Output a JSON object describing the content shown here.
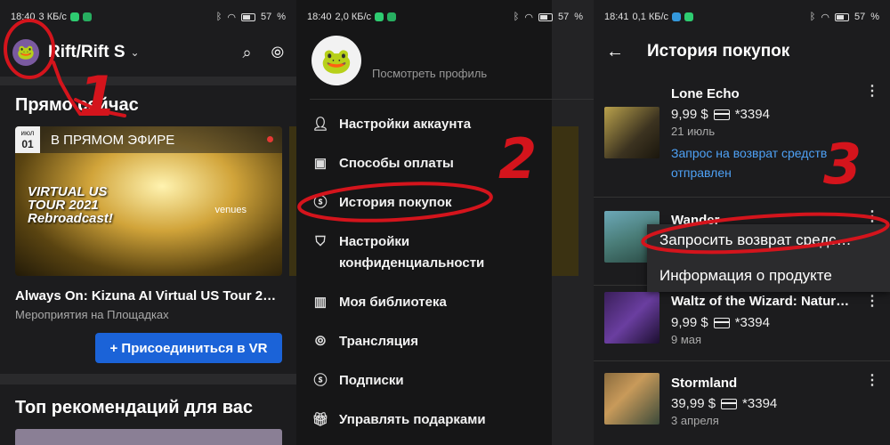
{
  "panel1": {
    "status": {
      "time": "18:40",
      "speed": "3 КБ/с",
      "battery": "57"
    },
    "title": "Rift/Rift S",
    "section_now": "Прямо сейчас",
    "live_label": "В ПРЯМОМ ЭФИРЕ",
    "date_month": "июл",
    "date_day": "01",
    "card_art_text": "VIRTUAL US TOUR 2021 Rebroadcast!",
    "card_art_brand": "venues",
    "event_title": "Always On: Kizuna AI Virtual US Tour 2…",
    "event_sub": "Мероприятия на Площадках",
    "join_button": "+ Присоединиться в VR",
    "section_rec": "Топ рекомендаций для вас",
    "annotation": "1"
  },
  "panel2": {
    "status": {
      "time": "18:40",
      "speed": "2,0 КБ/с",
      "battery": "57"
    },
    "view_profile": "Посмотреть профиль",
    "menu": [
      {
        "label": "Настройки аккаунта",
        "icon": "person-icon"
      },
      {
        "label": "Способы оплаты",
        "icon": "wallet-icon"
      },
      {
        "label": "История покупок",
        "icon": "dollar-circle-icon"
      },
      {
        "label": "Настройки конфиденциальности",
        "icon": "privacy-shield-icon"
      },
      {
        "label": "Моя библиотека",
        "icon": "book-icon"
      },
      {
        "label": "Трансляция",
        "icon": "cast-icon"
      },
      {
        "label": "Подписки",
        "icon": "dollar-circle-icon"
      },
      {
        "label": "Управлять подарками",
        "icon": "gift-icon"
      }
    ],
    "annotation": "2"
  },
  "panel3": {
    "status": {
      "time": "18:41",
      "speed": "0,1 КБ/с",
      "battery": "57"
    },
    "title": "История покупок",
    "purchases": [
      {
        "name": "Lone Echo",
        "price": "9,99 $",
        "card": "*3394",
        "date": "21 июль",
        "link": "Запрос на возврат средств отправлен"
      },
      {
        "name": "Wander",
        "price": "",
        "card": "",
        "date": "",
        "link": ""
      },
      {
        "name": "Waltz of the Wizard: Natur…",
        "price": "9,99 $",
        "card": "*3394",
        "date": "9 мая",
        "link": ""
      },
      {
        "name": "Stormland",
        "price": "39,99 $",
        "card": "*3394",
        "date": "3 апреля",
        "link": ""
      }
    ],
    "popup": {
      "refund": "Запросить возврат средс…",
      "info": "Информация о продукте"
    },
    "annotation": "3"
  },
  "colors": {
    "annotation_red": "#d4141c",
    "accent_blue": "#1b63d8",
    "link_blue": "#4ea1f5"
  }
}
